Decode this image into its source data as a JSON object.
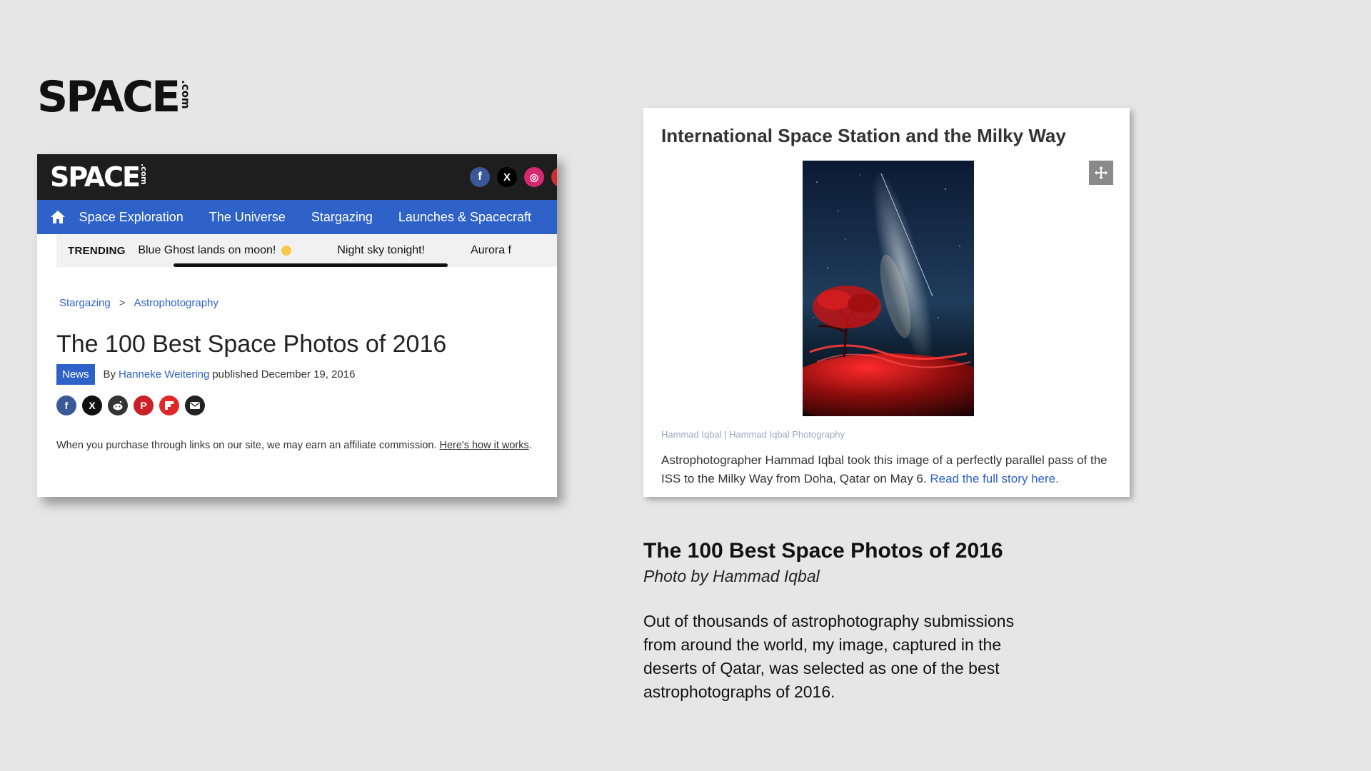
{
  "logo": {
    "word": "SPACE",
    "suffix": ".com"
  },
  "article": {
    "site_logo": {
      "word": "SPACE",
      "suffix": ".com"
    },
    "social": {
      "facebook": "f",
      "x": "X",
      "instagram": "◎"
    },
    "nav": [
      "Space Exploration",
      "The Universe",
      "Stargazing",
      "Launches & Spacecraft"
    ],
    "trending": {
      "label": "TRENDING",
      "items": [
        "Blue Ghost lands on moon!",
        "Night sky tonight!",
        "Aurora f"
      ]
    },
    "breadcrumb": [
      "Stargazing",
      ">",
      "Astrophotography"
    ],
    "title": "The 100 Best Space Photos of 2016",
    "badge": "News",
    "by": "By",
    "author": "Hanneke Weitering",
    "published": "published December 19, 2016",
    "share_icons": [
      "facebook-icon",
      "x-icon",
      "reddit-icon",
      "pinterest-icon",
      "flipboard-icon",
      "email-icon"
    ],
    "affiliate_text": "When you purchase through links on our site, we may earn an affiliate commission. ",
    "affiliate_link": "Here's how it works",
    "affiliate_end": "."
  },
  "photo_card": {
    "title": "International Space Station and the Milky Way",
    "credit": "Hammad Iqbal | Hammad Iqbal Photography",
    "caption": "Astrophotographer Hammad Iqbal took this image of a perfectly parallel pass of the ISS to the Milky Way from Doha, Qatar on May 6. ",
    "caption_link": "Read the full story here."
  },
  "headline": "The 100 Best Space Photos of 2016",
  "subhead": "Photo by Hammad Iqbal",
  "quote": "Out of thousands of astrophotography submissions from around the world, my image, captured in the deserts of Qatar, was selected as one of the best astrophotographs of 2016.",
  "colors": {
    "nav_blue": "#2e62c9",
    "dark_header": "#1e1e1e",
    "background": "#e6e6e6"
  }
}
